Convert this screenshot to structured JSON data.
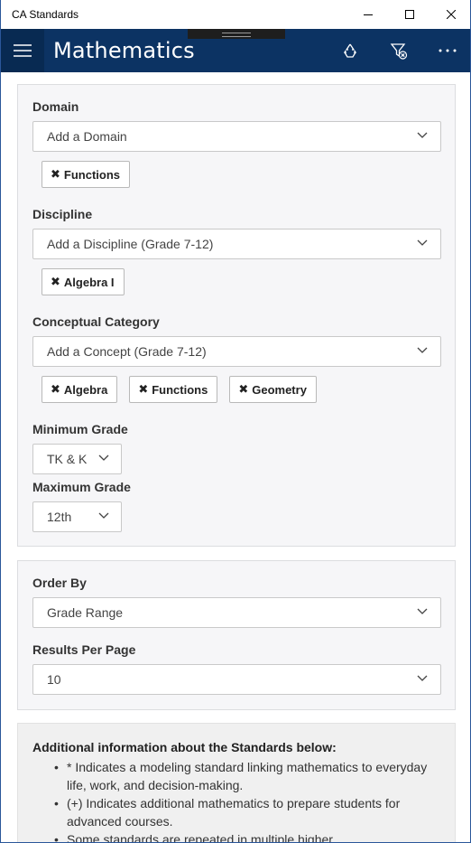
{
  "window": {
    "title": "CA Standards"
  },
  "appbar": {
    "title": "Mathematics",
    "icons": [
      "hamburger-icon",
      "recycle-icon",
      "clear-filter-icon",
      "more-icon"
    ]
  },
  "filters": {
    "domain": {
      "label": "Domain",
      "placeholder": "Add a Domain",
      "chips": [
        "Functions"
      ]
    },
    "discipline": {
      "label": "Discipline",
      "placeholder": "Add a Discipline (Grade 7-12)",
      "chips": [
        "Algebra I"
      ]
    },
    "concept": {
      "label": "Conceptual Category",
      "placeholder": "Add a Concept (Grade 7-12)",
      "chips": [
        "Algebra",
        "Functions",
        "Geometry"
      ]
    },
    "min_grade": {
      "label": "Minimum Grade",
      "value": "TK & K"
    },
    "max_grade": {
      "label": "Maximum Grade",
      "value": "12th"
    }
  },
  "sorting": {
    "order_by": {
      "label": "Order By",
      "value": "Grade Range"
    },
    "results_per_page": {
      "label": "Results Per Page",
      "value": "10"
    }
  },
  "info": {
    "title": "Additional information about the Standards below:",
    "items": [
      "* Indicates a modeling standard linking mathematics to everyday life, work, and decision-making.",
      "(+) Indicates additional mathematics to prepare students for advanced courses.",
      "Some standards are repeated in multiple higher"
    ]
  }
}
